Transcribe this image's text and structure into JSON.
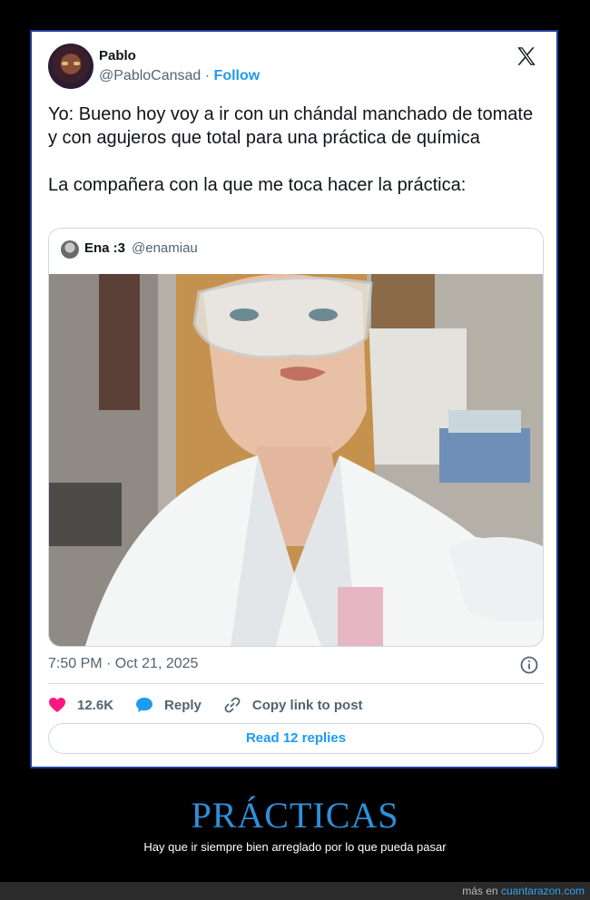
{
  "tweet": {
    "author_name": "Pablo",
    "author_handle": "@PabloCansad",
    "separator": "·",
    "follow_label": "Follow",
    "text_line1": "Yo: Bueno hoy voy a ir con un chándal manchado de tomate y con agujeros que total para una práctica de química",
    "text_line2": "La compañera con la que me toca hacer la práctica:",
    "timestamp": "7:50 PM · Oct 21, 2025",
    "likes_count": "12.6K",
    "reply_label": "Reply",
    "copy_link_label": "Copy link to post",
    "read_replies_label": "Read 12 replies"
  },
  "quote": {
    "author_name": "Ena :3",
    "author_handle": "@enamiau"
  },
  "meme": {
    "title": "PRÁCTICAS",
    "subtitle": "Hay que ir siempre bien arreglado por lo que pueda pasar"
  },
  "footer": {
    "prefix": "más en",
    "site": "cuantarazon.com"
  },
  "colors": {
    "accent": "#1d9bf0",
    "like": "#f91880",
    "title": "#2f8fd8",
    "card_border": "#1d3f9e"
  }
}
